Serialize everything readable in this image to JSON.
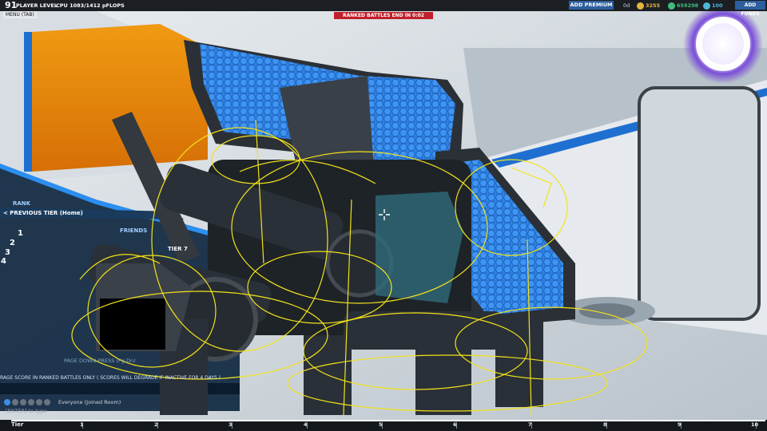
{
  "hud": {
    "player_level": "91",
    "player_level_label": "PLAYER LEVEL",
    "menu_label": "MENU (TAB)",
    "cpu_label": "CPU 1083/1412 pFLOPS",
    "ranked_label": "RANKED BATTLES END IN 0:02",
    "add_premium_label": "ADD PREMIUM",
    "premium_days": "0d",
    "robits": "3255",
    "tech_points": "659298",
    "cosmetic_credits": "100",
    "add_funds_label": "ADD FUNDS"
  },
  "leaderboard": {
    "rank_tab": "RANK",
    "previous_tier": "< PREVIOUS TIER (Home)",
    "friends_tab": "FRIENDS",
    "tier_label": "TIER 7",
    "rows": [
      "1",
      "2",
      "3",
      "4"
    ],
    "page_down_hint": "PAGE DOWN PRESS (Pg Dn)",
    "average_score_note": "RAGE SCORE IN RANKED BATTLES ONLY ( SCORES WILL DEGRADE IF INACTIVE FOR 4 DAYS )"
  },
  "chat": {
    "channel": "Everyone (Joined Room)",
    "input_hint": "[ENTER] to type"
  },
  "tier_bar": {
    "label": "Tier",
    "ticks": [
      "1",
      "2",
      "3",
      "4",
      "5",
      "6",
      "7",
      "8",
      "9",
      "10"
    ]
  },
  "colors": {
    "hud_bg": "#1b1f24",
    "ranked_red": "#c0202a",
    "button_blue": "#2d5f9e",
    "robits_gold": "#e6b53a",
    "tech_green": "#3fbf7a",
    "cosmetic_cyan": "#4fb7d8",
    "robot_blue": "#2f7fe0",
    "overlay_yellow": "#f2e21a"
  }
}
